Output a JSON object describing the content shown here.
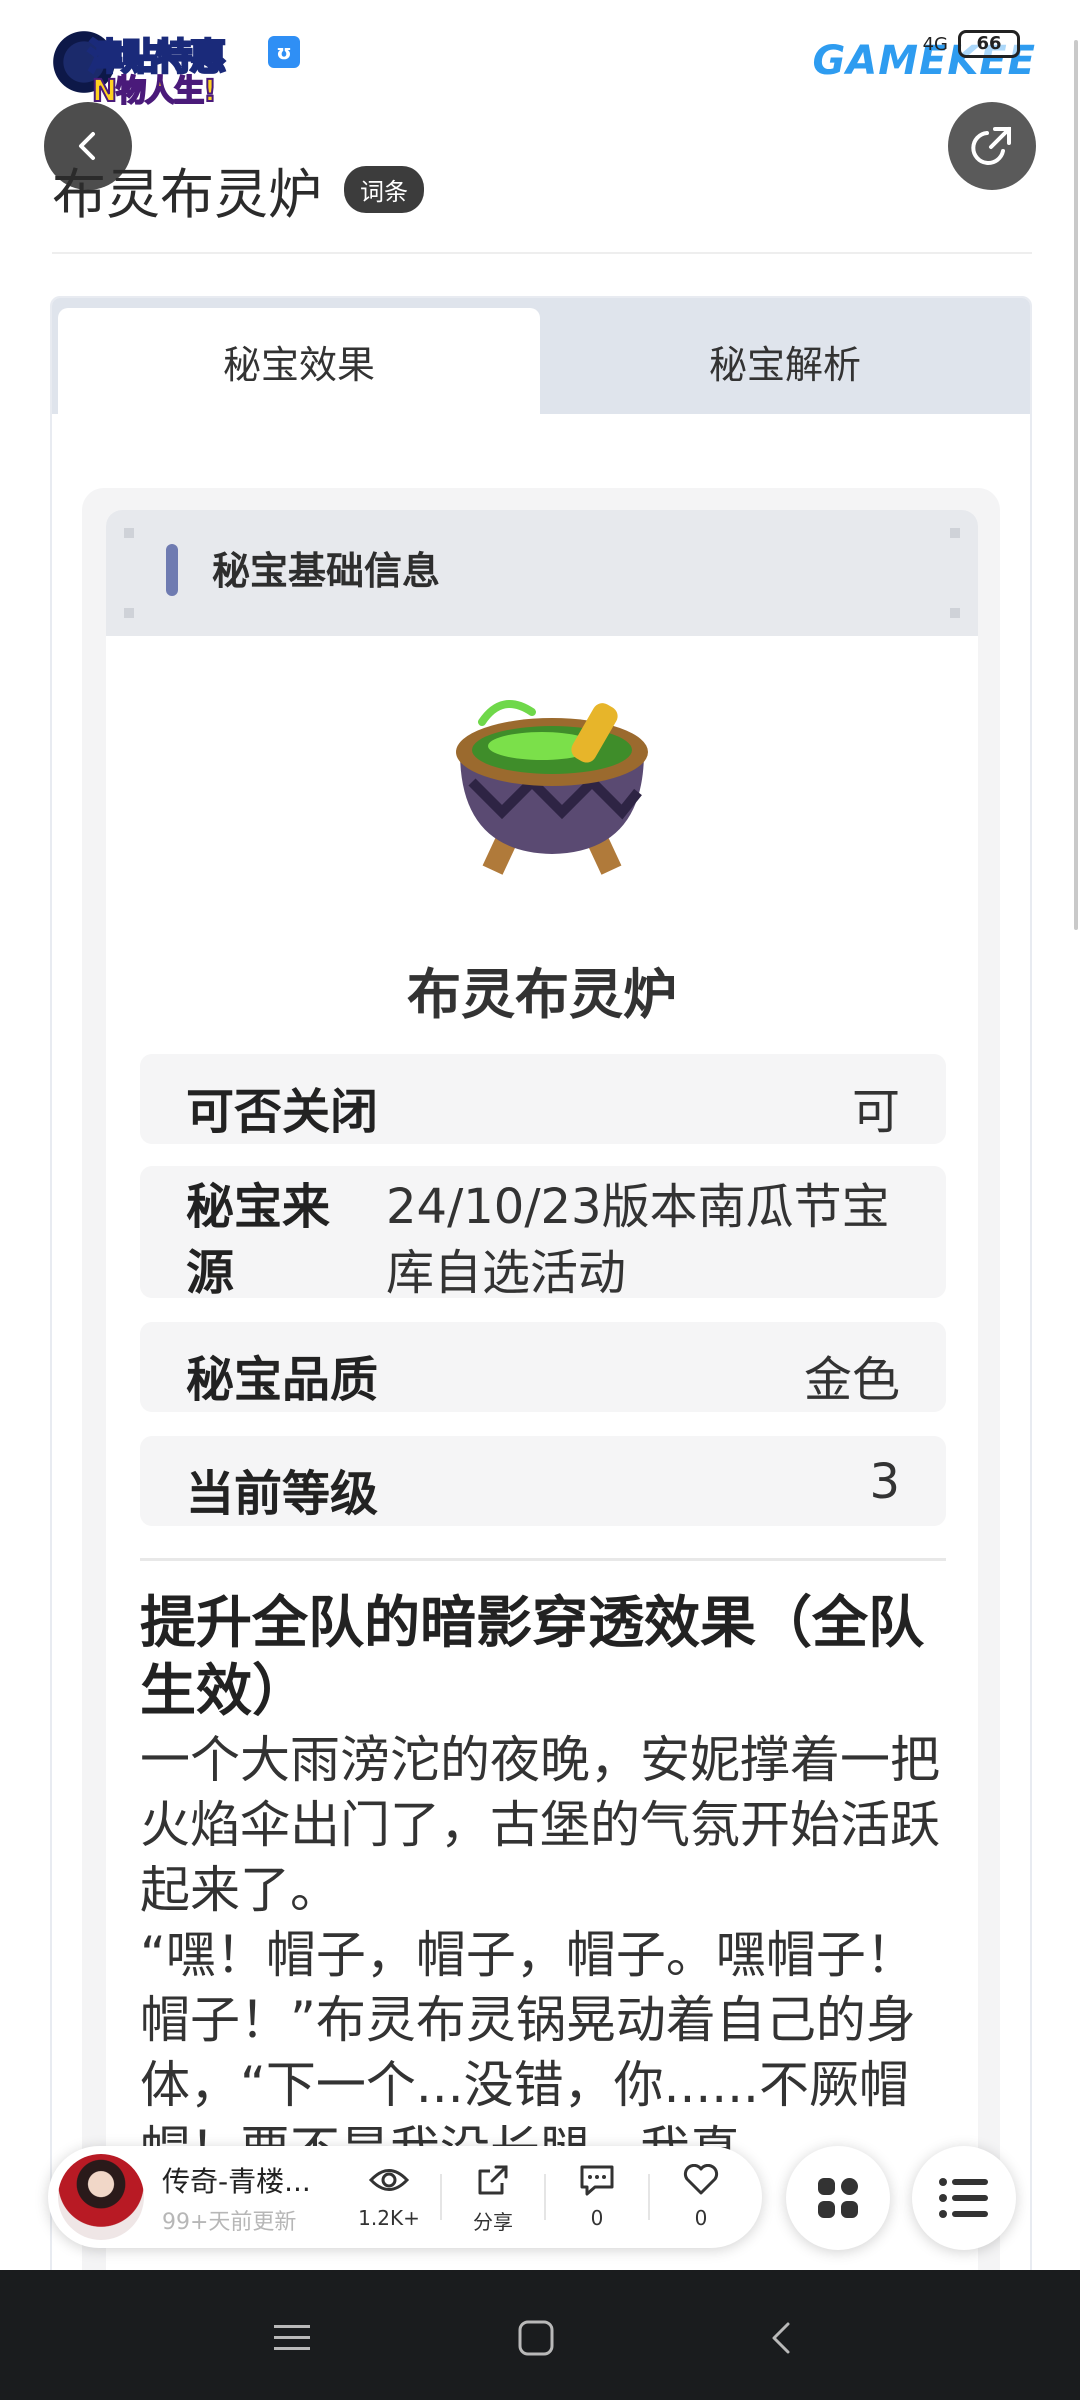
{
  "header": {
    "logo_line1": "津贴特惠",
    "logo_line2": "N物人生!",
    "brand": "GAMEKEE",
    "battery": "66",
    "network": "4G",
    "page_title": "布灵布灵炉",
    "tag": "词条"
  },
  "tabs": [
    {
      "label": "秘宝效果",
      "active": true
    },
    {
      "label": "秘宝解析",
      "active": false
    }
  ],
  "section": {
    "title": "秘宝基础信息",
    "item_name": "布灵布灵炉",
    "rows": [
      {
        "key": "可否关闭",
        "value": "可"
      },
      {
        "key": "秘宝来源",
        "value": "24/10/23版本南瓜节宝库自选活动"
      },
      {
        "key": "秘宝品质",
        "value": "金色"
      },
      {
        "key": "当前等级",
        "value": "3"
      }
    ],
    "effect_title": "提升全队的暗影穿透效果（全队生效）",
    "description": "一个大雨滂沱的夜晚，安妮撑着一把火焰伞出门了，古堡的气氛开始活跃起来了。\n“嘿！帽子，帽子，帽子。嘿帽子！帽子！”布灵布灵锅晃动着自己的身体，“下一个...没错，你......不厥帽帽！要不是我没长腿，我真"
  },
  "float_bar": {
    "title": "传奇-青楼...",
    "subtitle": "99+天前更新",
    "views": "1.2K+",
    "share": "分享",
    "comments": "0",
    "likes": "0"
  },
  "colors": {
    "accent": "#6f7bb1",
    "brand": "#2e9cf0",
    "tab_bg": "#dfe4ec",
    "dark_button": "#4d4d4d"
  }
}
